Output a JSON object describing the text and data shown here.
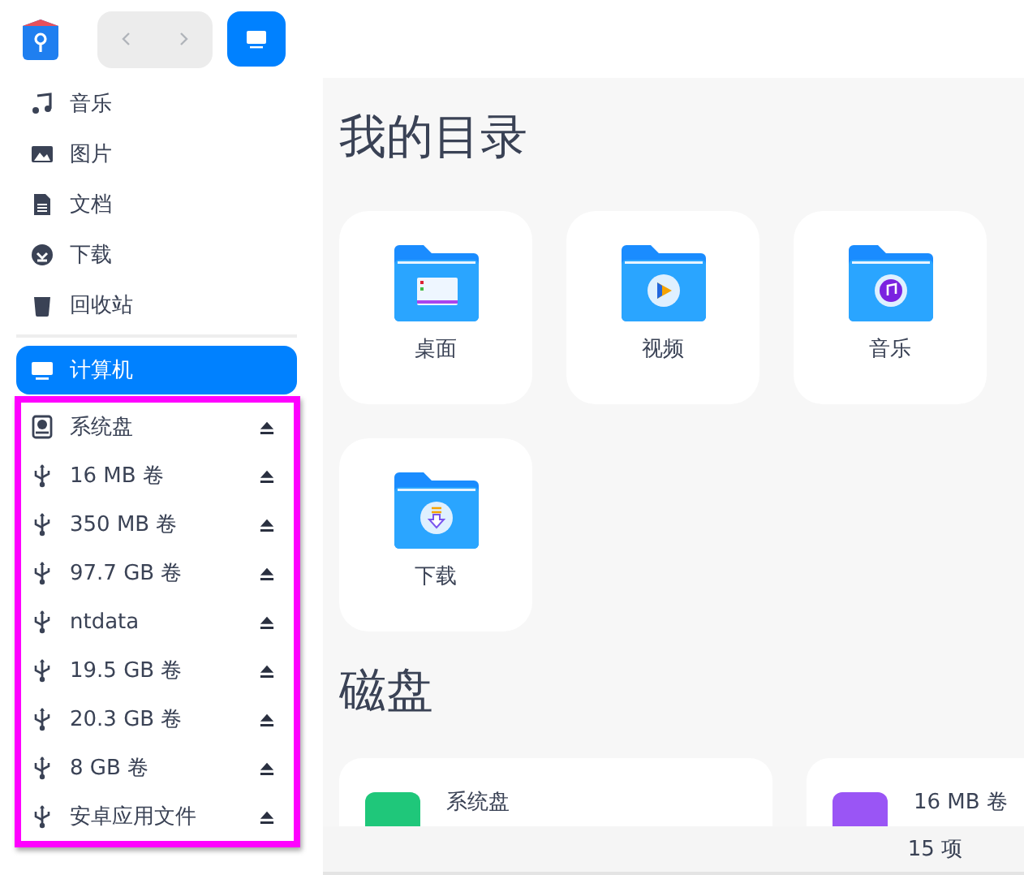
{
  "sidebar": {
    "places": [
      {
        "label": "音乐",
        "kind": "music",
        "selected": false
      },
      {
        "label": "图片",
        "kind": "picture",
        "selected": false
      },
      {
        "label": "文档",
        "kind": "document",
        "selected": false
      },
      {
        "label": "下载",
        "kind": "download",
        "selected": false
      },
      {
        "label": "回收站",
        "kind": "trash",
        "selected": false
      }
    ],
    "computer": [
      {
        "label": "计算机",
        "kind": "computer",
        "selected": true
      }
    ],
    "devices": [
      {
        "label": "系统盘",
        "kind": "disk",
        "selected": false
      },
      {
        "label": "16 MB 卷",
        "kind": "usb",
        "selected": false
      },
      {
        "label": "350 MB 卷",
        "kind": "usb",
        "selected": false
      },
      {
        "label": "97.7 GB 卷",
        "kind": "usb",
        "selected": false
      },
      {
        "label": "ntdata",
        "kind": "usb",
        "selected": false
      },
      {
        "label": "19.5 GB 卷",
        "kind": "usb",
        "selected": false
      },
      {
        "label": "20.3 GB 卷",
        "kind": "usb",
        "selected": false
      },
      {
        "label": "8 GB 卷",
        "kind": "usb",
        "selected": false
      },
      {
        "label": "安卓应用文件",
        "kind": "usb",
        "selected": false
      }
    ]
  },
  "main": {
    "folders_heading": "我的目录",
    "folders": [
      {
        "label": "桌面",
        "kind": "desktop"
      },
      {
        "label": "视频",
        "kind": "video"
      },
      {
        "label": "音乐",
        "kind": "music"
      },
      {
        "label": "下载",
        "kind": "download"
      }
    ],
    "disks_heading": "磁盘",
    "disks": [
      {
        "label": "系统盘",
        "kind": "system"
      },
      {
        "label": "16 MB 卷",
        "kind": "usb"
      }
    ]
  },
  "status_bar": {
    "count": "15 项"
  }
}
